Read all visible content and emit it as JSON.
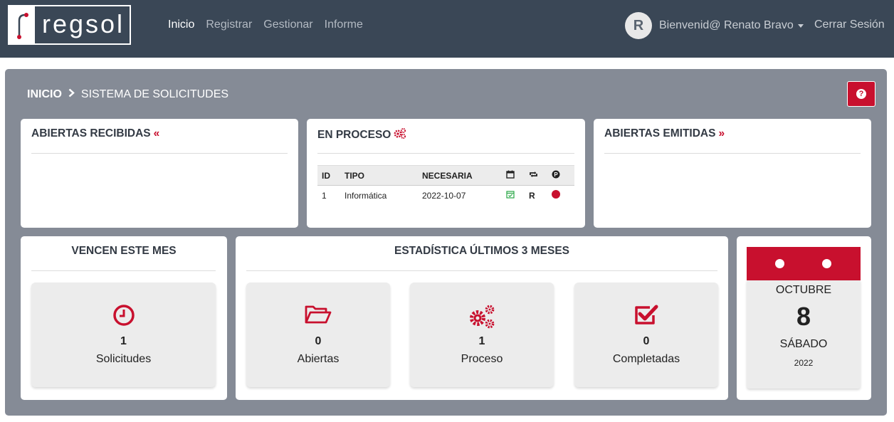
{
  "brand": {
    "logo_text": "regsol"
  },
  "nav": {
    "links": [
      "Inicio",
      "Registrar",
      "Gestionar",
      "Informe"
    ],
    "active": "Inicio"
  },
  "user": {
    "initial": "R",
    "greeting": "Bienvenid@ Renato Bravo",
    "logout": "Cerrar Sesión"
  },
  "breadcrumb": {
    "root": "INICIO",
    "current": "SISTEMA DE SOLICITUDES"
  },
  "help_icon": "question-circle-icon",
  "cards": {
    "abiertas_recibidas": {
      "title": "ABIERTAS RECIBIDAS",
      "icon": "«"
    },
    "en_proceso": {
      "title": "EN PROCESO",
      "columns": [
        "ID",
        "TIPO",
        "NECESARIA"
      ],
      "icon_columns": [
        "calendar-icon",
        "repeat-icon",
        "priority-icon"
      ],
      "rows": [
        {
          "id": "1",
          "tipo": "Informática",
          "necesaria": "2022-10-07",
          "repeat": "R"
        }
      ]
    },
    "abiertas_emitidas": {
      "title": "ABIERTAS EMITIDAS",
      "icon": "»"
    }
  },
  "vencen": {
    "title": "VENCEN ESTE MES",
    "count": "1",
    "label": "Solicitudes"
  },
  "estadistica": {
    "title": "ESTADÍSTICA ÚLTIMOS 3 MESES",
    "items": [
      {
        "count": "0",
        "label": "Abiertas"
      },
      {
        "count": "1",
        "label": "Proceso"
      },
      {
        "count": "0",
        "label": "Completadas"
      }
    ]
  },
  "calendar": {
    "month": "OCTUBRE",
    "day": "8",
    "weekday": "SÁBADO",
    "year": "2022"
  },
  "colors": {
    "accent": "#c8102e",
    "navbar": "#3a4756",
    "panel": "#858b96"
  }
}
